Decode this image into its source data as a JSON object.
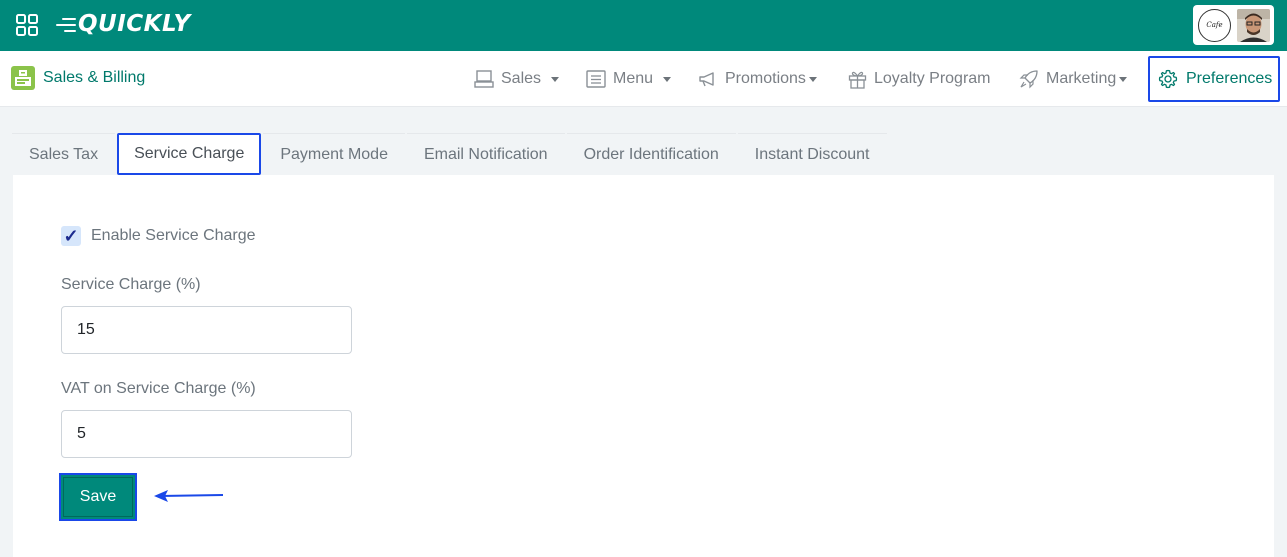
{
  "topbar": {
    "logo_text": "QUICKLY",
    "apps_icon": "grid-icon",
    "brand_badge_text": "Cafe"
  },
  "navbar": {
    "module_title": "Sales & Billing",
    "items": [
      {
        "label": "Sales",
        "icon": "register-icon",
        "has_caret": true
      },
      {
        "label": "Menu",
        "icon": "menu-list-icon",
        "has_caret": true
      },
      {
        "label": "Promotions",
        "icon": "megaphone-icon",
        "has_caret": true
      },
      {
        "label": "Loyalty Program",
        "icon": "gift-icon",
        "has_caret": false
      },
      {
        "label": "Marketing",
        "icon": "rocket-icon",
        "has_caret": true
      }
    ],
    "preferences_label": "Preferences"
  },
  "tabs": [
    {
      "label": "Sales Tax",
      "active": false
    },
    {
      "label": "Service Charge",
      "active": true
    },
    {
      "label": "Payment Mode",
      "active": false
    },
    {
      "label": "Email Notification",
      "active": false
    },
    {
      "label": "Order Identification",
      "active": false
    },
    {
      "label": "Instant Discount",
      "active": false
    }
  ],
  "form": {
    "enable_label": "Enable Service Charge",
    "enable_checked": true,
    "service_charge_label": "Service Charge (%)",
    "service_charge_value": "15",
    "vat_label": "VAT on Service Charge (%)",
    "vat_value": "5",
    "save_label": "Save"
  },
  "colors": {
    "brand": "#00897b",
    "brand_text": "#00796b",
    "highlight": "#1a48e8"
  }
}
